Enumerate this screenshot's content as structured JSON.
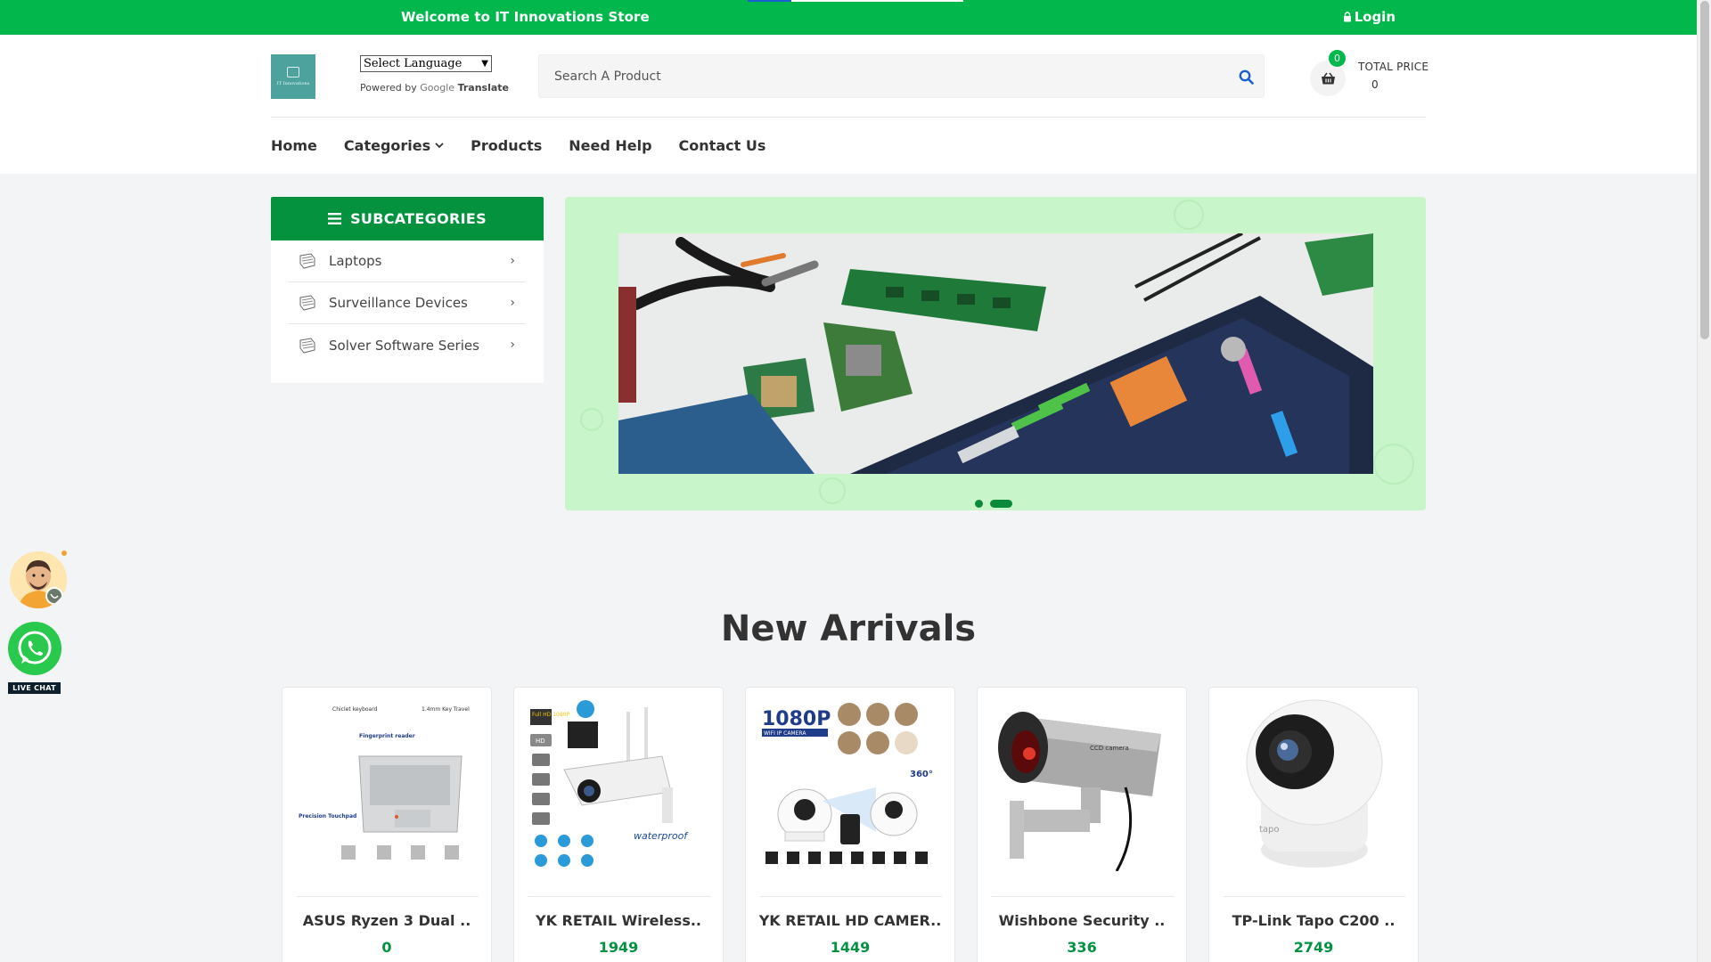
{
  "topbar": {
    "welcome": "Welcome to IT Innovations Store",
    "login": "Login"
  },
  "header": {
    "logo_text": "IT Innovations",
    "language_select": "Select Language",
    "powered_by": "Powered by",
    "powered_google": "Google",
    "powered_translate": "Translate",
    "search_placeholder": "Search A Product",
    "cart_count": "0",
    "total_label": "TOTAL PRICE",
    "total_value": "0"
  },
  "nav": {
    "items": [
      {
        "label": "Home"
      },
      {
        "label": "Categories"
      },
      {
        "label": "Products"
      },
      {
        "label": "Need Help"
      },
      {
        "label": "Contact Us"
      }
    ]
  },
  "subcategories": {
    "title": "SUBCATEGORIES",
    "items": [
      {
        "label": "Laptops"
      },
      {
        "label": "Surveillance Devices"
      },
      {
        "label": "Solver Software Series"
      }
    ]
  },
  "banner": {
    "slides_total": 2,
    "active_slide": 2
  },
  "new_arrivals": {
    "title": "New Arrivals",
    "products": [
      {
        "name": "ASUS Ryzen 3 Dual ..",
        "price": "0"
      },
      {
        "name": "YK RETAIL Wireless..",
        "price": "1949"
      },
      {
        "name": "YK RETAIL HD CAMER..",
        "price": "1449"
      },
      {
        "name": "Wishbone Security ..",
        "price": "336"
      },
      {
        "name": "TP-Link Tapo C200 ..",
        "price": "2749"
      }
    ],
    "product_image_text": {
      "laptop": [
        "Chiclet keyboard",
        "1.4mm Key Travel",
        "Fingerprint reader",
        "Precision Touchpad"
      ],
      "wireless_cam": [
        "Full HD 1080P",
        "HD",
        "waterproof"
      ],
      "hd_cam": [
        "1080P",
        "WIFI IP CAMERA",
        "360°"
      ],
      "ccd": [
        "CCD camera"
      ],
      "tapo": [
        "tapo"
      ]
    }
  },
  "live_chat": {
    "label": "LIVE CHAT"
  },
  "colors": {
    "brand_green": "#02b74b",
    "dark_green": "#04923f",
    "price_green": "#049142",
    "banner_bg": "#c8f5c9"
  }
}
